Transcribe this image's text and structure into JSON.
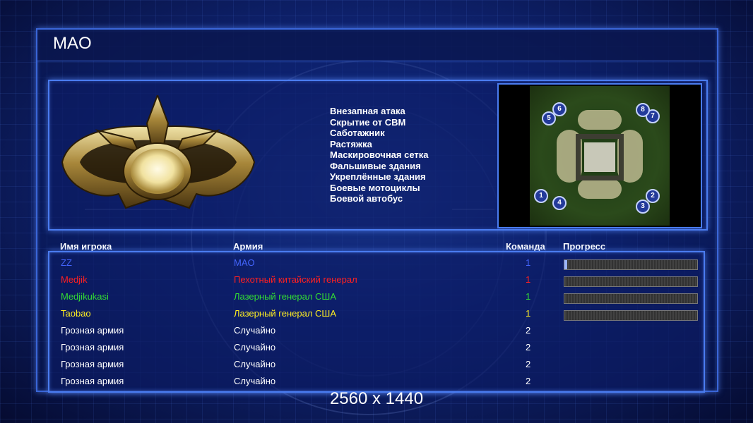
{
  "game_title": "MAO",
  "rules": [
    "Внезапная атака",
    "Скрытие от СВМ",
    "Саботажник",
    "Растяжка",
    "Маскировочная сетка",
    "Фальшивые здания",
    "Укреплённые здания",
    "Боевые мотоциклы",
    "Боевой автобус"
  ],
  "table": {
    "headers": {
      "player": "Имя игрока",
      "army": "Армия",
      "team": "Команда",
      "progress": "Прогресс"
    },
    "rows": [
      {
        "player": "ZZ",
        "army": "MAO",
        "team": "1",
        "color": "#4466ff",
        "progress": 0.02
      },
      {
        "player": "Medjik",
        "army": "Пехотный китайский генерал",
        "team": "1",
        "color": "#ff2020",
        "progress": 0
      },
      {
        "player": "Medjikukasi",
        "army": "Лазерный генерал США",
        "team": "1",
        "color": "#33dd33",
        "progress": 0
      },
      {
        "player": "Taobao",
        "army": "Лазерный генерал США",
        "team": "1",
        "color": "#ffee22",
        "progress": 0
      },
      {
        "player": "Грозная армия",
        "army": "Случайно",
        "team": "2",
        "color": "#ffffff"
      },
      {
        "player": "Грозная армия",
        "army": "Случайно",
        "team": "2",
        "color": "#ffffff"
      },
      {
        "player": "Грозная армия",
        "army": "Случайно",
        "team": "2",
        "color": "#ffffff"
      },
      {
        "player": "Грозная армия",
        "army": "Случайно",
        "team": "2",
        "color": "#ffffff"
      }
    ]
  },
  "map_slots": [
    "1",
    "2",
    "3",
    "4",
    "5",
    "6",
    "7",
    "8"
  ],
  "footer": "2560 x 1440"
}
